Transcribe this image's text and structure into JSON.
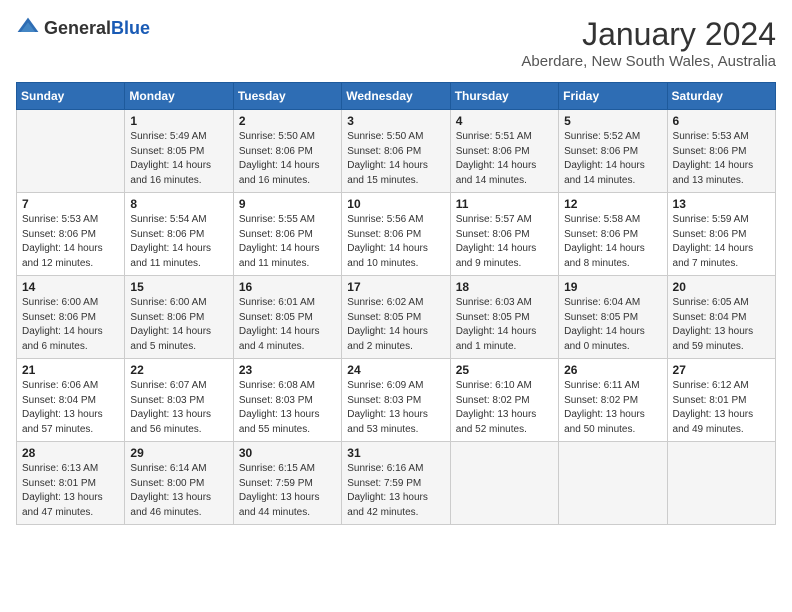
{
  "header": {
    "logo_general": "General",
    "logo_blue": "Blue",
    "month": "January 2024",
    "location": "Aberdare, New South Wales, Australia"
  },
  "days_of_week": [
    "Sunday",
    "Monday",
    "Tuesday",
    "Wednesday",
    "Thursday",
    "Friday",
    "Saturday"
  ],
  "weeks": [
    [
      {
        "day": "",
        "info": ""
      },
      {
        "day": "1",
        "info": "Sunrise: 5:49 AM\nSunset: 8:05 PM\nDaylight: 14 hours\nand 16 minutes."
      },
      {
        "day": "2",
        "info": "Sunrise: 5:50 AM\nSunset: 8:06 PM\nDaylight: 14 hours\nand 16 minutes."
      },
      {
        "day": "3",
        "info": "Sunrise: 5:50 AM\nSunset: 8:06 PM\nDaylight: 14 hours\nand 15 minutes."
      },
      {
        "day": "4",
        "info": "Sunrise: 5:51 AM\nSunset: 8:06 PM\nDaylight: 14 hours\nand 14 minutes."
      },
      {
        "day": "5",
        "info": "Sunrise: 5:52 AM\nSunset: 8:06 PM\nDaylight: 14 hours\nand 14 minutes."
      },
      {
        "day": "6",
        "info": "Sunrise: 5:53 AM\nSunset: 8:06 PM\nDaylight: 14 hours\nand 13 minutes."
      }
    ],
    [
      {
        "day": "7",
        "info": "Sunrise: 5:53 AM\nSunset: 8:06 PM\nDaylight: 14 hours\nand 12 minutes."
      },
      {
        "day": "8",
        "info": "Sunrise: 5:54 AM\nSunset: 8:06 PM\nDaylight: 14 hours\nand 11 minutes."
      },
      {
        "day": "9",
        "info": "Sunrise: 5:55 AM\nSunset: 8:06 PM\nDaylight: 14 hours\nand 11 minutes."
      },
      {
        "day": "10",
        "info": "Sunrise: 5:56 AM\nSunset: 8:06 PM\nDaylight: 14 hours\nand 10 minutes."
      },
      {
        "day": "11",
        "info": "Sunrise: 5:57 AM\nSunset: 8:06 PM\nDaylight: 14 hours\nand 9 minutes."
      },
      {
        "day": "12",
        "info": "Sunrise: 5:58 AM\nSunset: 8:06 PM\nDaylight: 14 hours\nand 8 minutes."
      },
      {
        "day": "13",
        "info": "Sunrise: 5:59 AM\nSunset: 8:06 PM\nDaylight: 14 hours\nand 7 minutes."
      }
    ],
    [
      {
        "day": "14",
        "info": "Sunrise: 6:00 AM\nSunset: 8:06 PM\nDaylight: 14 hours\nand 6 minutes."
      },
      {
        "day": "15",
        "info": "Sunrise: 6:00 AM\nSunset: 8:06 PM\nDaylight: 14 hours\nand 5 minutes."
      },
      {
        "day": "16",
        "info": "Sunrise: 6:01 AM\nSunset: 8:05 PM\nDaylight: 14 hours\nand 4 minutes."
      },
      {
        "day": "17",
        "info": "Sunrise: 6:02 AM\nSunset: 8:05 PM\nDaylight: 14 hours\nand 2 minutes."
      },
      {
        "day": "18",
        "info": "Sunrise: 6:03 AM\nSunset: 8:05 PM\nDaylight: 14 hours\nand 1 minute."
      },
      {
        "day": "19",
        "info": "Sunrise: 6:04 AM\nSunset: 8:05 PM\nDaylight: 14 hours\nand 0 minutes."
      },
      {
        "day": "20",
        "info": "Sunrise: 6:05 AM\nSunset: 8:04 PM\nDaylight: 13 hours\nand 59 minutes."
      }
    ],
    [
      {
        "day": "21",
        "info": "Sunrise: 6:06 AM\nSunset: 8:04 PM\nDaylight: 13 hours\nand 57 minutes."
      },
      {
        "day": "22",
        "info": "Sunrise: 6:07 AM\nSunset: 8:03 PM\nDaylight: 13 hours\nand 56 minutes."
      },
      {
        "day": "23",
        "info": "Sunrise: 6:08 AM\nSunset: 8:03 PM\nDaylight: 13 hours\nand 55 minutes."
      },
      {
        "day": "24",
        "info": "Sunrise: 6:09 AM\nSunset: 8:03 PM\nDaylight: 13 hours\nand 53 minutes."
      },
      {
        "day": "25",
        "info": "Sunrise: 6:10 AM\nSunset: 8:02 PM\nDaylight: 13 hours\nand 52 minutes."
      },
      {
        "day": "26",
        "info": "Sunrise: 6:11 AM\nSunset: 8:02 PM\nDaylight: 13 hours\nand 50 minutes."
      },
      {
        "day": "27",
        "info": "Sunrise: 6:12 AM\nSunset: 8:01 PM\nDaylight: 13 hours\nand 49 minutes."
      }
    ],
    [
      {
        "day": "28",
        "info": "Sunrise: 6:13 AM\nSunset: 8:01 PM\nDaylight: 13 hours\nand 47 minutes."
      },
      {
        "day": "29",
        "info": "Sunrise: 6:14 AM\nSunset: 8:00 PM\nDaylight: 13 hours\nand 46 minutes."
      },
      {
        "day": "30",
        "info": "Sunrise: 6:15 AM\nSunset: 7:59 PM\nDaylight: 13 hours\nand 44 minutes."
      },
      {
        "day": "31",
        "info": "Sunrise: 6:16 AM\nSunset: 7:59 PM\nDaylight: 13 hours\nand 42 minutes."
      },
      {
        "day": "",
        "info": ""
      },
      {
        "day": "",
        "info": ""
      },
      {
        "day": "",
        "info": ""
      }
    ]
  ]
}
